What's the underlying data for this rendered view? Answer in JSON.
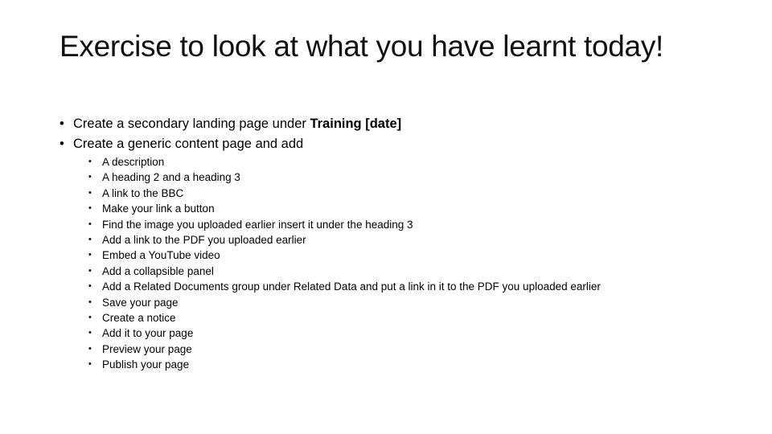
{
  "slide": {
    "title": "Exercise to look at what you have learnt today!",
    "bullets": [
      {
        "text": "Create a secondary landing page under ",
        "bold": "Training [date]"
      },
      {
        "text": "Create a generic content page and add",
        "bold": ""
      }
    ],
    "sub_bullets": [
      "A description",
      "A heading 2 and a heading 3",
      "A link to the BBC",
      "Make your link a button",
      "Find the image you uploaded earlier insert it under the heading 3",
      "Add a link to the PDF you uploaded earlier",
      "Embed a YouTube video",
      "Add a collapsible panel",
      "Add a Related Documents group under Related Data and put a link in it to the PDF you uploaded earlier",
      "Save your page",
      "Create a notice",
      "Add it to your page",
      "Preview your page",
      "Publish your page"
    ],
    "bullet_glyph": "•"
  }
}
